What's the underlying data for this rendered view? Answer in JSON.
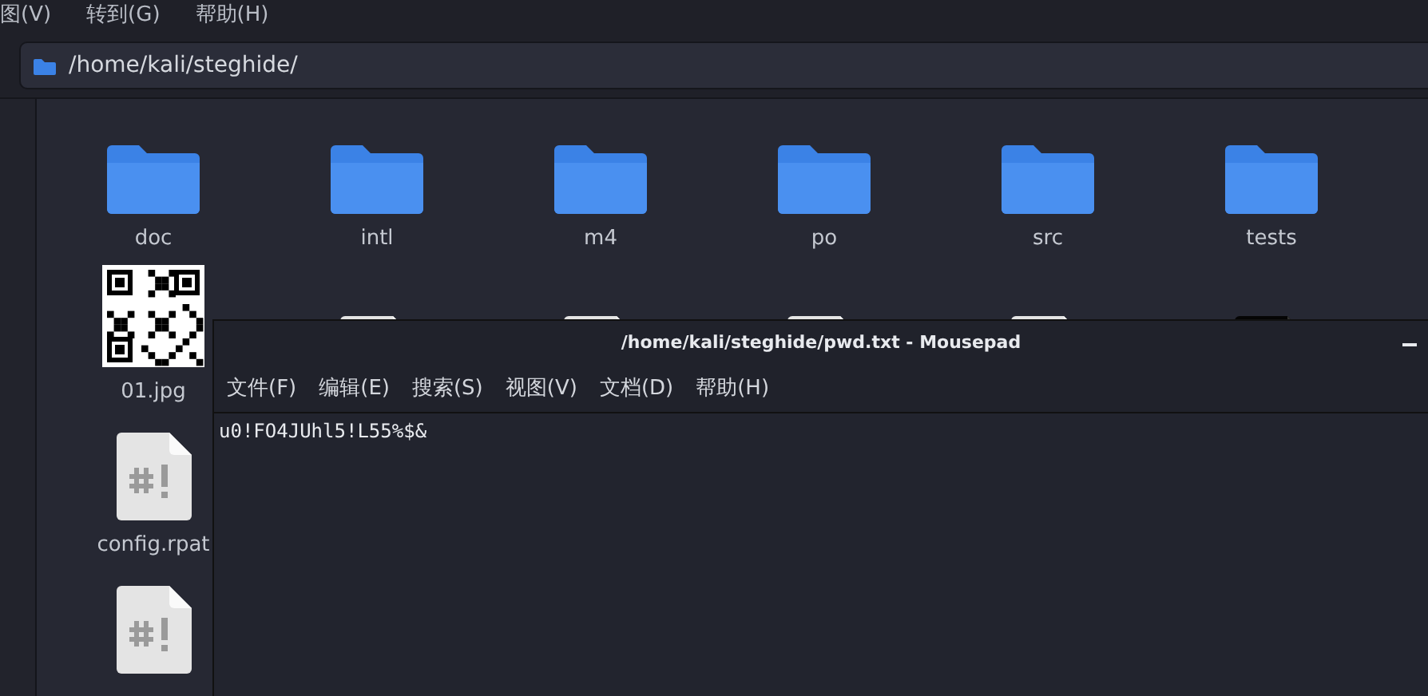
{
  "menubar": [
    {
      "label": "图(V)"
    },
    {
      "label": "转到(G)"
    },
    {
      "label": "帮助(H)"
    }
  ],
  "location": "/home/kali/steghide/",
  "files": [
    {
      "kind": "folder",
      "name": "doc"
    },
    {
      "kind": "folder",
      "name": "intl"
    },
    {
      "kind": "folder",
      "name": "m4"
    },
    {
      "kind": "folder",
      "name": "po"
    },
    {
      "kind": "folder",
      "name": "src"
    },
    {
      "kind": "folder",
      "name": "tests"
    },
    {
      "kind": "qr",
      "name": "01.jpg"
    },
    {
      "kind": "text"
    },
    {
      "kind": "document"
    },
    {
      "kind": "text"
    },
    {
      "kind": "script"
    },
    {
      "kind": "dark"
    },
    {
      "kind": "script",
      "name": "config.rpat"
    },
    {
      "kind": "empty"
    },
    {
      "kind": "empty"
    },
    {
      "kind": "empty"
    },
    {
      "kind": "empty"
    },
    {
      "kind": "empty"
    },
    {
      "kind": "script"
    }
  ],
  "editor": {
    "title": "/home/kali/steghide/pwd.txt - Mousepad",
    "menu": [
      {
        "label": "文件(F)"
      },
      {
        "label": "编辑(E)"
      },
      {
        "label": "搜索(S)"
      },
      {
        "label": "视图(V)"
      },
      {
        "label": "文档(D)"
      },
      {
        "label": "帮助(H)"
      }
    ],
    "content": "u0!FO4JUhl5!L55%$&"
  }
}
